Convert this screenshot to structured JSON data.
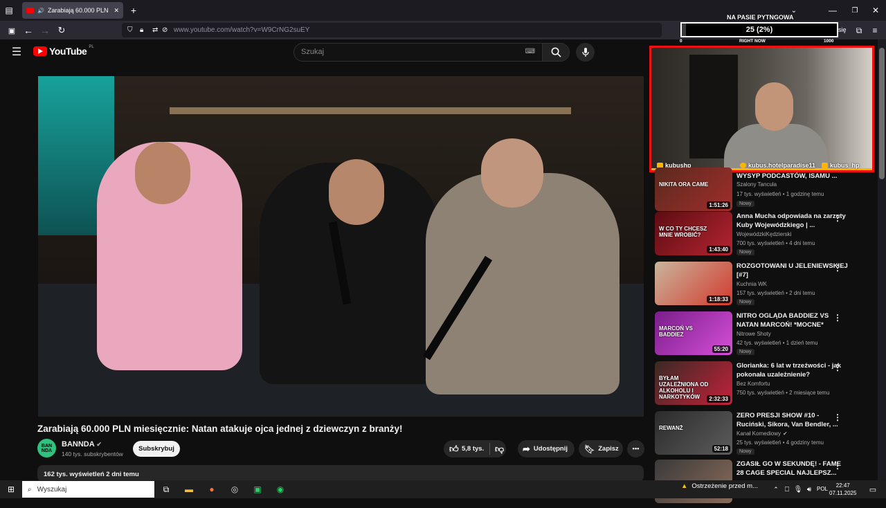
{
  "browser": {
    "tab_title": "Zarabiają 60.000 PLN miesięcznie: Natan atakuje ojca jednej z dziewczyn z branży!",
    "tab_title_short": "Zarabiają 60.000 PLN mies",
    "url": "www.youtube.com/watch?v=W9CrNG2suEY",
    "sign_in_fragment": "się"
  },
  "youtube": {
    "logo_text": "YouTube",
    "region": "PL",
    "search_placeholder": "Szukaj"
  },
  "video": {
    "title": "Zarabiają 60.000 PLN miesięcznie: Natan atakuje ojca jednej z dziewczyn z branży!",
    "channel": "BANNDA",
    "channel_avatar_text": "BAN NDA",
    "subscribers": "140 tys. subskrybentów",
    "subscribe_label": "Subskrybuj",
    "likes": "5,8 tys.",
    "share_label": "Udostępnij",
    "save_label": "Zapisz",
    "views_date": "162 tys. wyświetleń  2 dni temu"
  },
  "overlay": {
    "goal_title": "NA PASIE PYTNGOWA",
    "goal_value": "25 (2%)",
    "goal_progress": 0.025,
    "min": "0",
    "center": "RIGHT NOW",
    "max": "1000",
    "socials": [
      "kubushp",
      "kubus.hotelparadise11",
      "kubus_hp"
    ]
  },
  "recommendations": [
    {
      "title": "WYSYP PODCASTÓW, ISAMU ...",
      "channel": "Szalony Tancula",
      "meta": "17 tys. wyświetleń • 1 godzinę temu",
      "duration": "1:51:26",
      "badge": "Nowy",
      "thumb_text": "NIKITA ORA CAME",
      "colors": [
        "#5a2a1f",
        "#a12d2a"
      ]
    },
    {
      "title": "Anna Mucha odpowiada na zarzuty Kuby Wojewódzkiego | ...",
      "channel": "WojewódzkiKędzierski",
      "meta": "700 tys. wyświetleń • 4 dni temu",
      "duration": "1:43:40",
      "badge": "Nowy",
      "thumb_text": "W CO TY CHCESZ MNIE WROBIĆ?",
      "colors": [
        "#5d0d12",
        "#b42431"
      ]
    },
    {
      "title": "ROZGOTOWANI U JELENIEWSKIEJ [#7]",
      "channel": "Kuchnia WK",
      "meta": "157 tys. wyświetleń • 2 dni temu",
      "duration": "1:18:33",
      "badge": "Nowy",
      "thumb_text": "",
      "colors": [
        "#c9b59c",
        "#d23a2e"
      ]
    },
    {
      "title": "NITRO OGLĄDA BADDIEZ VS NATAN MARCOŃ! *MOCNE*",
      "channel": "Nitrowe Shoty",
      "meta": "42 tys. wyświetleń • 1 dzień temu",
      "duration": "55:20",
      "badge": "Nowy",
      "thumb_text": "MARCOŃ VS BADDIEZ",
      "colors": [
        "#7a1e8a",
        "#d64fd8"
      ]
    },
    {
      "title": "Glorianka: 6 lat w trzeźwości - jak pokonała uzależnienie?",
      "channel": "Bez Komfortu",
      "meta": "750 tys. wyświetleń • 2 miesiące temu",
      "duration": "2:32:33",
      "badge": "",
      "thumb_text": "BYŁAM UZALEŻNIONA OD ALKOHOLU I NARKOTYKÓW",
      "colors": [
        "#3a2a25",
        "#c3213a"
      ]
    },
    {
      "title": "ZERO PRESJI SHOW #10 - Ruciński, Sikora, Van Bendler, ...",
      "channel": "Kanał Komediowy",
      "meta": "25 tys. wyświetleń • 4 godziny temu",
      "duration": "52:18",
      "badge": "Nowy",
      "thumb_text": "REWANŻ",
      "colors": [
        "#2b2b2b",
        "#5c5c5c"
      ]
    },
    {
      "title": "ZGASIŁ GO W SEKUNDĘ! - FAME 28 CAGE SPECIAL NAJLEPSZ...",
      "channel": "",
      "meta": "",
      "duration": "",
      "badge": "",
      "thumb_text": "",
      "colors": [
        "#3a3a3a",
        "#8a6b5a"
      ]
    }
  ],
  "taskbar": {
    "search_placeholder": "Wyszukaj",
    "warning": "Ostrzeżenie przed m...",
    "lang": "POL",
    "time": "22:47",
    "date": "07.11.2025"
  }
}
